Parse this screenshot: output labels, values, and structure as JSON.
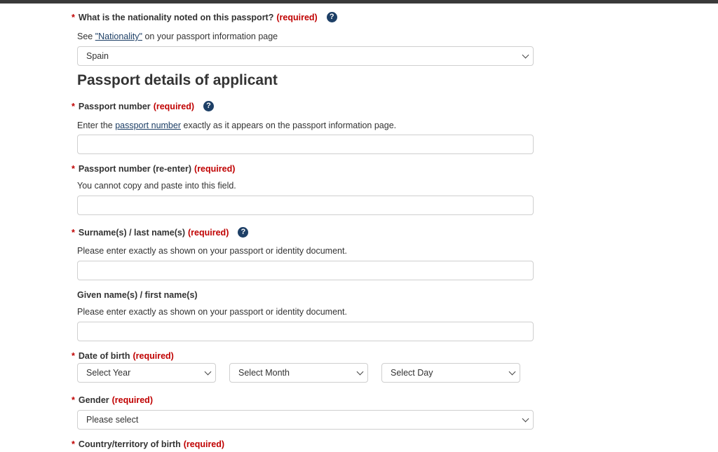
{
  "nationality": {
    "label": "What is the nationality noted on this passport?",
    "required": "(required)",
    "hint_prefix": "See ",
    "hint_link": "\"Nationality\"",
    "hint_suffix": " on your passport information page",
    "selected": "Spain"
  },
  "section_title": "Passport details of applicant",
  "passport_number": {
    "label": "Passport number",
    "required": "(required)",
    "hint_prefix": "Enter the ",
    "hint_link": "passport number",
    "hint_suffix": " exactly as it appears on the passport information page.",
    "value": ""
  },
  "passport_reenter": {
    "label": "Passport number (re-enter)",
    "required": "(required)",
    "hint": "You cannot copy and paste into this field.",
    "value": ""
  },
  "surname": {
    "label": "Surname(s) / last name(s)",
    "required": "(required)",
    "hint": "Please enter exactly as shown on your passport or identity document.",
    "value": ""
  },
  "given_name": {
    "label": "Given name(s) / first name(s)",
    "hint": "Please enter exactly as shown on your passport or identity document.",
    "value": ""
  },
  "dob": {
    "label": "Date of birth",
    "required": "(required)",
    "year": "Select Year",
    "month": "Select Month",
    "day": "Select Day"
  },
  "gender": {
    "label": "Gender",
    "required": "(required)",
    "selected": "Please select"
  },
  "country_of_birth": {
    "label": "Country/territory of birth",
    "required": "(required)"
  },
  "symbols": {
    "star": "*",
    "help": "?"
  },
  "icons": {
    "help": "question-circle-icon",
    "dropdown": "chevron-down-icon"
  },
  "colors": {
    "required": "#c00000",
    "link": "#1d3f66",
    "help_icon_bg": "#1d3f66"
  }
}
